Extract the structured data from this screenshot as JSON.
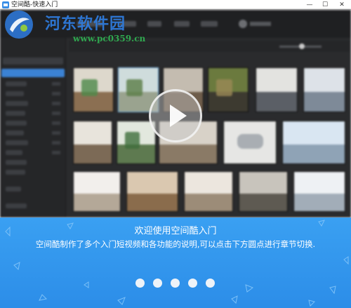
{
  "window": {
    "title": "空间酷-快速入门",
    "controls": {
      "minimize": "—",
      "maximize": "☐",
      "close": "✕"
    }
  },
  "watermark": {
    "site_name": "河东软件园",
    "url": "www.pc0359.cn"
  },
  "player": {
    "play_icon": "play-icon"
  },
  "tour": {
    "title": "欢迎使用空间酷入门",
    "description": "空间酷制作了多个入门短视频和各功能的说明,可以点击下方圆点进行章节切换.",
    "chapter_count": 5,
    "active_chapter": 1
  },
  "colors": {
    "panel_blue": "#2c8de8",
    "app_dark": "#2a2b2d",
    "accent": "#3b82d4",
    "watermark_blue": "#2f7de0",
    "watermark_green": "#2fa84f"
  }
}
